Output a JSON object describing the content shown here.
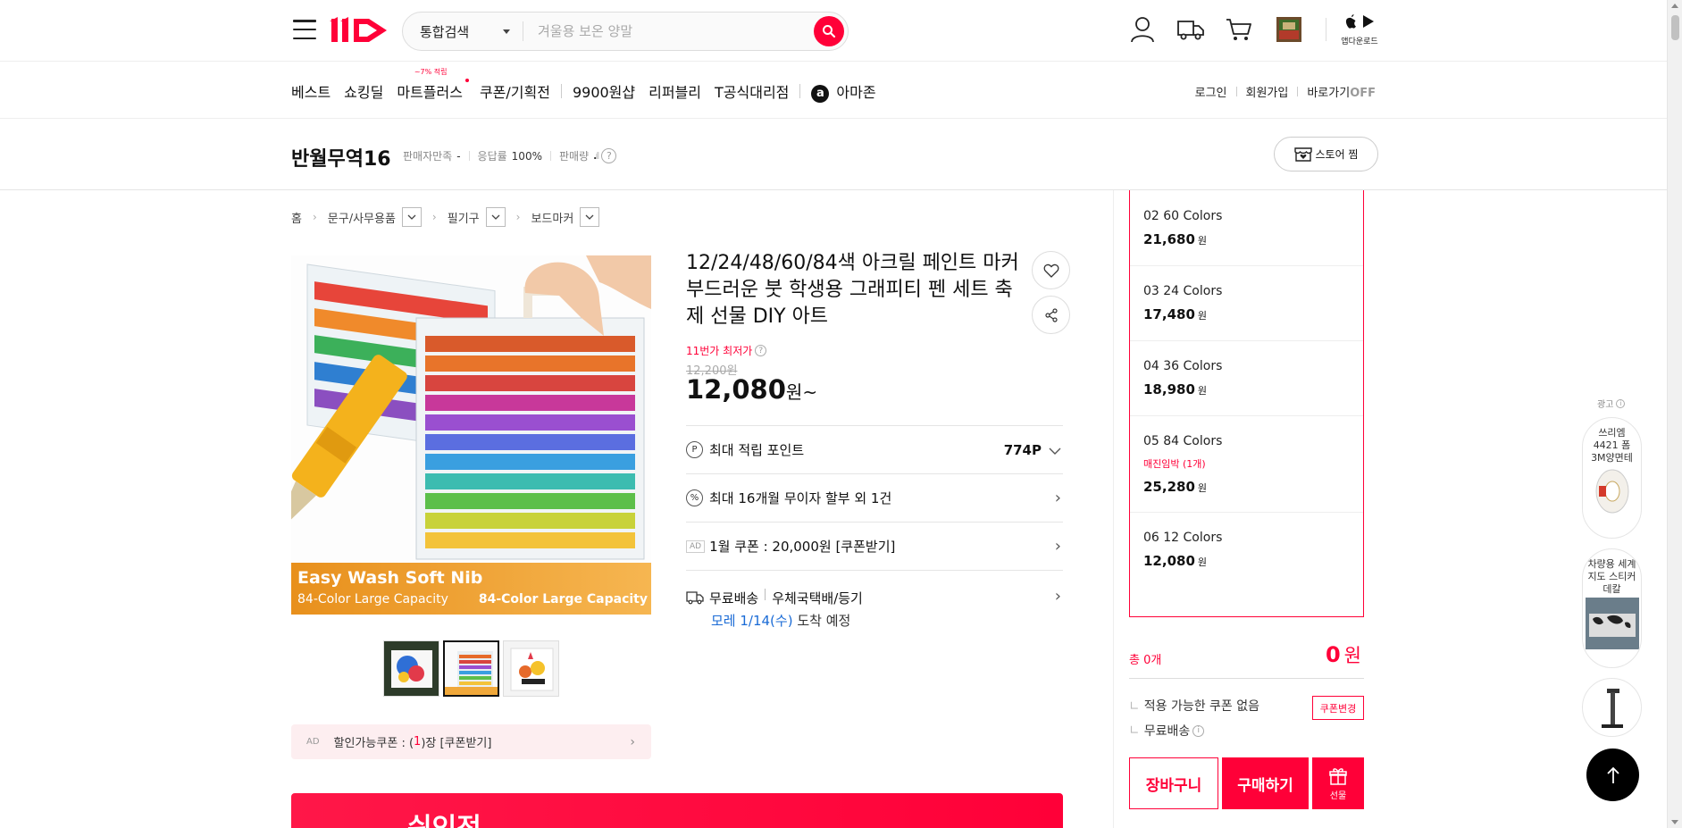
{
  "header": {
    "search_category": "통합검색",
    "search_placeholder": "겨울용 보온 양말",
    "app_download_label": "앱다운로드"
  },
  "gnb": {
    "items": [
      {
        "label": "베스트"
      },
      {
        "label": "쇼킹딜"
      },
      {
        "label": "마트플러스",
        "badge": "~7% 적립"
      },
      {
        "label": "쿠폰/기획전"
      },
      {
        "label": "9900원샵"
      },
      {
        "label": "리퍼블리"
      },
      {
        "label": "T공식대리점"
      },
      {
        "label": "아마존"
      }
    ],
    "login": "로그인",
    "signup": "회원가입",
    "shortcut": "바로가기",
    "shortcut_state": "OFF"
  },
  "seller": {
    "name": "반월무역16",
    "satisfaction_label": "판매자만족",
    "satisfaction_value": "-",
    "response_label": "응답률",
    "response_value": "100%",
    "sales_label": "판매량",
    "store_button": "스토어 찜"
  },
  "breadcrumb": [
    "홈",
    "문구/사무용품",
    "필기구",
    "보드마커"
  ],
  "product": {
    "title": "12/24/48/60/84색 아크릴 페인트 마커 부드러운 붓 학생용 그래피티 펜 세트 축제 선물 DIY 아트",
    "lowest_label": "11번가 최저가",
    "original_price": "12,200원",
    "price": "12,080",
    "price_suffix": "원~",
    "image_text_1": "Easy Wash Soft Nib",
    "image_text_2": "84-Color Large Capacity",
    "image_text_3": "84-Color Large Capacity",
    "coupon_bar": {
      "ad": "AD",
      "prefix": "할인가능쿠폰 : (",
      "count": "1",
      "suffix": ")장 [쿠폰받기]"
    }
  },
  "benefits": {
    "points_label": "최대 적립 포인트",
    "points_value": "774P",
    "installment": "최대 16개월 무이자 할부 외 1건",
    "coupon_ad": "AD",
    "coupon": "1월 쿠폰 : 20,000원 [쿠폰받기]",
    "shipping_label": "무료배송",
    "shipping_method": "우체국택배/등기",
    "arrival_date": "모레 1/14(수)",
    "arrival_suffix": " 도착 예정"
  },
  "options": [
    {
      "name": "02 60 Colors",
      "price": "21,680",
      "stock": ""
    },
    {
      "name": "03 24 Colors",
      "price": "17,480",
      "stock": ""
    },
    {
      "name": "04 36 Colors",
      "price": "18,980",
      "stock": ""
    },
    {
      "name": "05 84 Colors",
      "price": "25,280",
      "stock": "매진임박 (1개)"
    },
    {
      "name": "06 12 Colors",
      "price": "12,080",
      "stock": ""
    }
  ],
  "won": "원",
  "order": {
    "total_label": "총 0개",
    "total_amount": "0",
    "coupon_none": "적용 가능한 쿠폰 없음",
    "coupon_change": "쿠폰변경",
    "free_shipping": "무료배송",
    "cart": "장바구니",
    "buy": "구매하기",
    "gift": "선물"
  },
  "ads": {
    "label": "광고",
    "item1": "쓰리엠 4421 폼 3M양면테",
    "item2": "차량용 세계지도 스티커 데칼"
  },
  "promo_banner_text": "쉬인전",
  "colors": {
    "brand_red": "#ff0038",
    "link_blue": "#1a6bd6"
  }
}
